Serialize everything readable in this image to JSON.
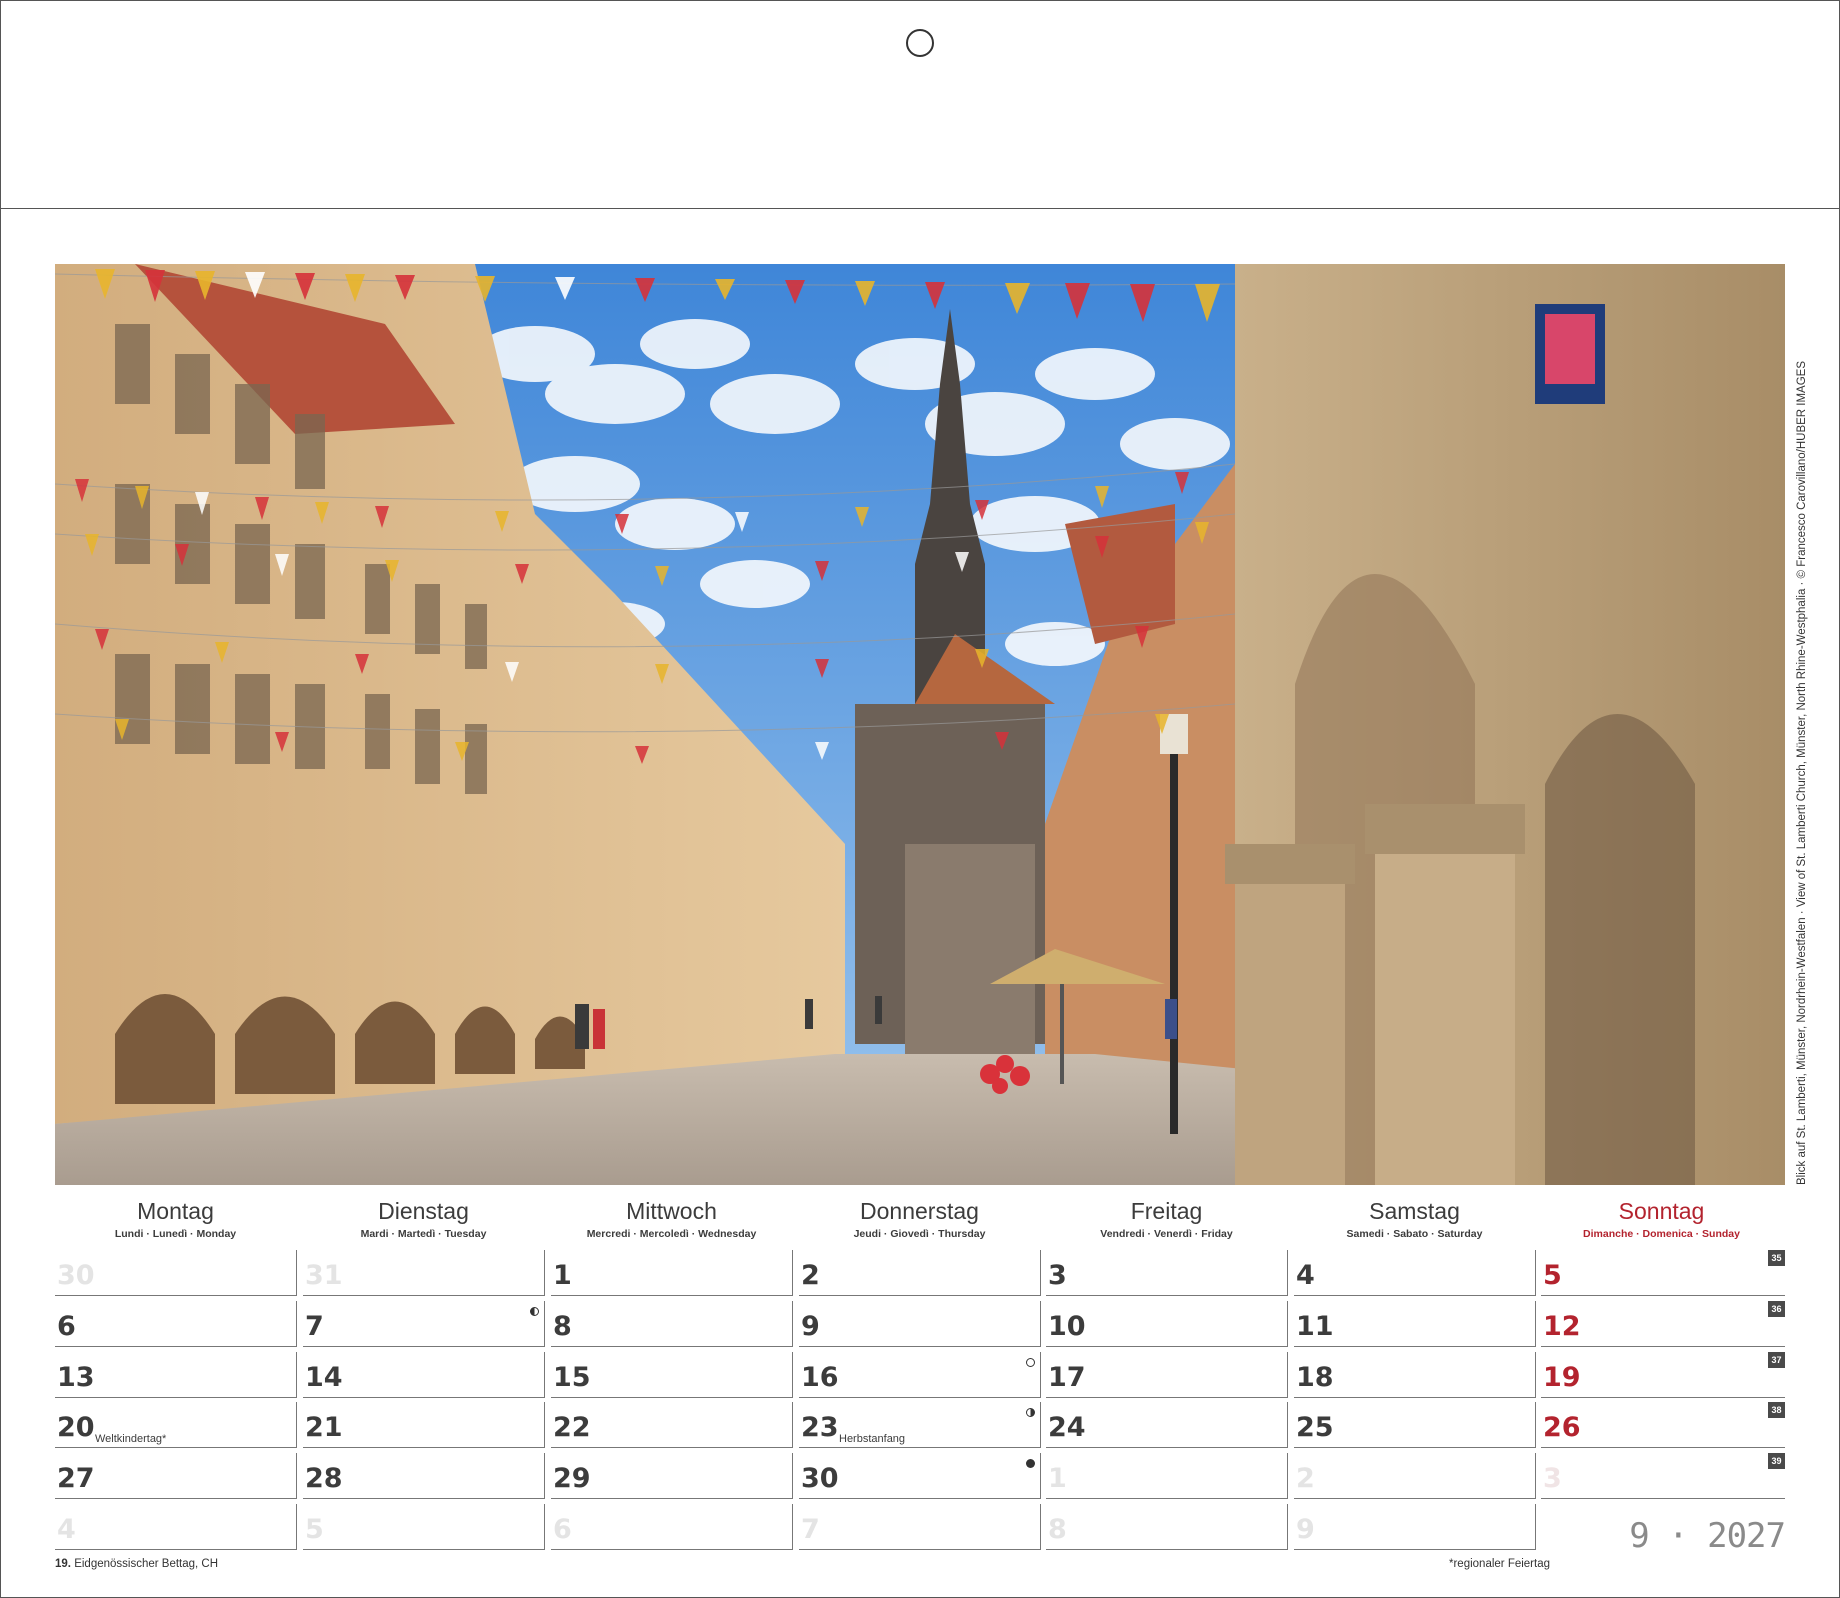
{
  "photo": {
    "credit": "Blick auf St. Lamberti, Münster, Nordrhein-Westfalen · View of St. Lamberti Church, Münster, North Rhine-Westphalia · © Francesco Carovillano/HUBER IMAGES"
  },
  "weekdays": [
    {
      "name": "Montag",
      "sub": "Lundi · Lunedì · Monday"
    },
    {
      "name": "Dienstag",
      "sub": "Mardi · Martedì · Tuesday"
    },
    {
      "name": "Mittwoch",
      "sub": "Mercredi · Mercoledì · Wednesday"
    },
    {
      "name": "Donnerstag",
      "sub": "Jeudi · Giovedì · Thursday"
    },
    {
      "name": "Freitag",
      "sub": "Vendredi · Venerdì · Friday"
    },
    {
      "name": "Samstag",
      "sub": "Samedi · Sabato · Saturday"
    },
    {
      "name": "Sonntag",
      "sub": "Dimanche · Domenica · Sunday"
    }
  ],
  "weeks": [
    {
      "number": "35",
      "days": [
        "30",
        "31",
        "1",
        "2",
        "3",
        "4",
        "5"
      ]
    },
    {
      "number": "36",
      "days": [
        "6",
        "7",
        "8",
        "9",
        "10",
        "11",
        "12"
      ]
    },
    {
      "number": "37",
      "days": [
        "13",
        "14",
        "15",
        "16",
        "17",
        "18",
        "19"
      ]
    },
    {
      "number": "38",
      "days": [
        "20",
        "21",
        "22",
        "23",
        "24",
        "25",
        "26"
      ]
    },
    {
      "number": "39",
      "days": [
        "27",
        "28",
        "29",
        "30",
        "1",
        "2",
        "3"
      ]
    },
    {
      "number": "",
      "days": [
        "4",
        "5",
        "6",
        "7",
        "8",
        "9",
        ""
      ]
    }
  ],
  "notes": {
    "weltkindertag": "Weltkindertag*",
    "herbstanfang": "Herbstanfang"
  },
  "moon_phases": [
    {
      "day": "7",
      "phase": "last-quarter"
    },
    {
      "day": "16",
      "phase": "full-moon"
    },
    {
      "day": "23",
      "phase": "first-quarter"
    },
    {
      "day": "30",
      "phase": "new-moon"
    }
  ],
  "month_year": "9 · 2027",
  "footnotes": {
    "left_day": "19.",
    "left_text": " Eidgenössischer Bettag, CH",
    "right": "*regionaler Feiertag"
  },
  "colors": {
    "sunday": "#b3232e",
    "text": "#3c3c3c",
    "dim": "#e4e4e4"
  }
}
